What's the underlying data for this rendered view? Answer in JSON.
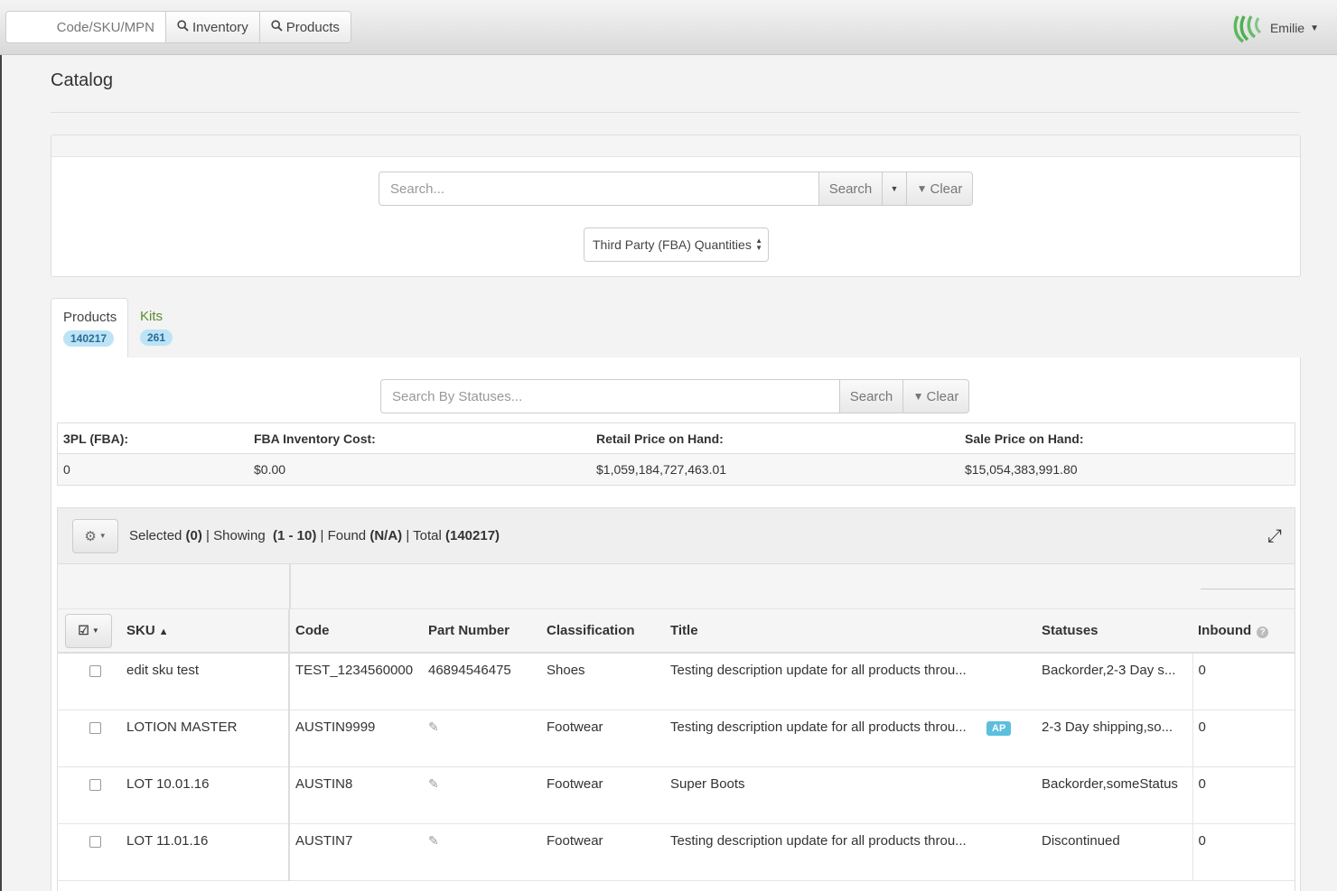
{
  "topbar": {
    "code_field": "Code/SKU/MPN",
    "inventory_label": "Inventory",
    "products_label": "Products",
    "user_name": "Emilie",
    "logo_color": "#4caf50"
  },
  "page": {
    "title": "Catalog"
  },
  "search": {
    "placeholder": "Search...",
    "search_label": "Search",
    "clear_label": "Clear",
    "quantity_select": "Third Party (FBA) Quantities"
  },
  "tabs": [
    {
      "label": "Products",
      "count": "140217"
    },
    {
      "label": "Kits",
      "count": "261"
    }
  ],
  "status_search": {
    "placeholder": "Search By Statuses...",
    "search_label": "Search",
    "clear_label": "Clear"
  },
  "summary": {
    "headers": [
      "3PL (FBA):",
      "FBA Inventory Cost:",
      "Retail Price on Hand:",
      "Sale Price on Hand:"
    ],
    "values": [
      "0",
      "$0.00",
      "$1,059,184,727,463.01",
      "$15,054,383,991.80"
    ]
  },
  "grid": {
    "selected_label": "Selected",
    "selected_count": "(0)",
    "showing_label": "Showing",
    "showing_range": "(1 - 10)",
    "found_label": "Found",
    "found_count": "(N/A)",
    "total_label": "Total",
    "total_count": "(140217)",
    "columns": [
      "SKU",
      "Code",
      "Part Number",
      "Classification",
      "Title",
      "Statuses",
      "Inbound"
    ],
    "rows": [
      {
        "sku": "edit sku test",
        "code": "TEST_1234560000",
        "part": "46894546475",
        "classification": "Shoes",
        "title": "Testing description update for all products throu...",
        "badge": "",
        "statuses": "Backorder,2-3 Day s...",
        "inbound": "0"
      },
      {
        "sku": "LOTION MASTER",
        "code": "AUSTIN9999",
        "part": "",
        "classification": "Footwear",
        "title": "Testing description update for all products throu...",
        "badge": "AP",
        "statuses": "2-3 Day shipping,so...",
        "inbound": "0"
      },
      {
        "sku": "LOT 10.01.16",
        "code": "AUSTIN8",
        "part": "",
        "classification": "Footwear",
        "title": "Super Boots",
        "badge": "",
        "statuses": "Backorder,someStatus",
        "inbound": "0"
      },
      {
        "sku": "LOT 11.01.16",
        "code": "AUSTIN7",
        "part": "",
        "classification": "Footwear",
        "title": "Testing description update for all products throu...",
        "badge": "",
        "statuses": "Discontinued",
        "inbound": "0"
      }
    ]
  }
}
